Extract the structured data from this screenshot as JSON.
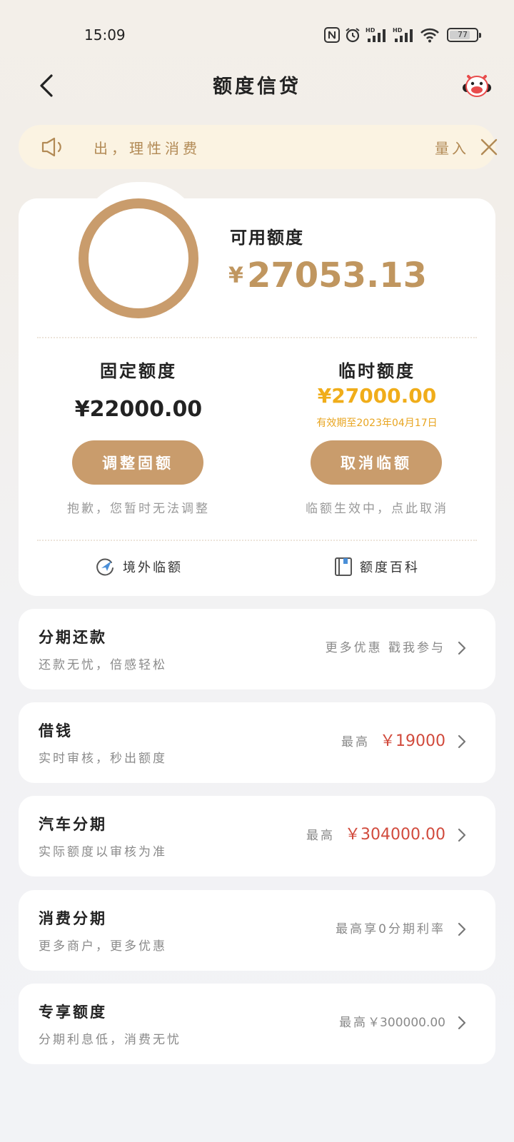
{
  "status_bar": {
    "time": "15:09",
    "battery": "77",
    "battery_level": 0.77
  },
  "header": {
    "title": "额度信贷"
  },
  "notice": {
    "text": "出，理性消费",
    "link": "量入"
  },
  "credit": {
    "available_label": "可用额度",
    "available_currency": "¥",
    "available_amount": "27053.13",
    "fixed": {
      "title": "固定额度",
      "amount": "¥22000.00",
      "button": "调整固额",
      "note": "抱歉，您暂时无法调整"
    },
    "temporary": {
      "title": "临时额度",
      "amount": "¥27000.00",
      "valid_until": "有效期至2023年04月17日",
      "button": "取消临额",
      "note": "临额生效中，点此取消"
    },
    "links": [
      {
        "label": "境外临额",
        "icon": "plane-globe-icon"
      },
      {
        "label": "额度百科",
        "icon": "book-icon"
      }
    ]
  },
  "services": [
    {
      "title": "分期还款",
      "subtitle": "还款无忧，倍感轻松",
      "right": "更多优惠 戳我参与",
      "highlight": ""
    },
    {
      "title": "借钱",
      "subtitle": "实时审核，秒出额度",
      "right": "最高",
      "highlight": "￥19000"
    },
    {
      "title": "汽车分期",
      "subtitle": "实际额度以审核为准",
      "right": "最高",
      "highlight": "￥304000.00"
    },
    {
      "title": "消费分期",
      "subtitle": "更多商户，更多优惠",
      "right": "最高享0分期利率",
      "highlight": ""
    },
    {
      "title": "专享额度",
      "subtitle": "分期利息低，消费无忧",
      "right": "最高",
      "highlight": "￥300000.00"
    }
  ],
  "colors": {
    "accent": "#c99c6c",
    "available_amount": "#c0965f",
    "temp_amount": "#f0ad1a",
    "highlight_red": "#d14a3c",
    "notice_bg": "#fbf3e2"
  }
}
